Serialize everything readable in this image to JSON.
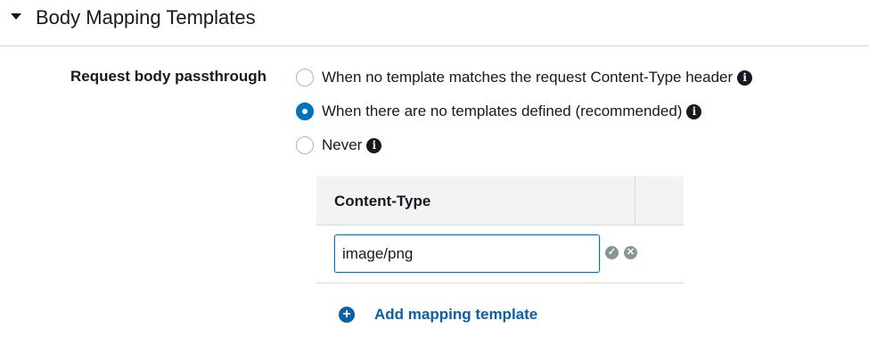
{
  "section": {
    "title": "Body Mapping Templates",
    "expanded": true
  },
  "passthrough": {
    "label": "Request body passthrough",
    "options": [
      {
        "label": "When no template matches the request Content-Type header",
        "selected": false,
        "info_icon": "info-icon"
      },
      {
        "label": "When there are no templates defined (recommended)",
        "selected": true,
        "info_icon": "info-icon"
      },
      {
        "label": "Never",
        "selected": false,
        "info_icon": "info-icon"
      }
    ]
  },
  "templates_table": {
    "column_header": "Content-Type",
    "rows": [
      {
        "content_type": "image/png",
        "editing": true
      }
    ]
  },
  "add_template": {
    "label": "Add mapping template",
    "icon": "plus-circle-icon"
  },
  "colors": {
    "accent": "#0073bb",
    "link": "#0b5ea8",
    "muted_icon": "#879596",
    "header_bg": "#f2f3f3"
  }
}
